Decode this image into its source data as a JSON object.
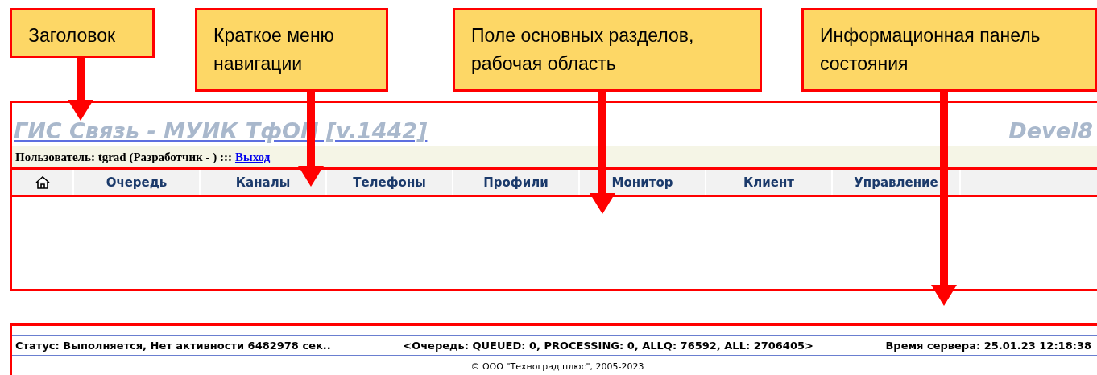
{
  "annotations": [
    {
      "text": "Заголовок"
    },
    {
      "text": "Краткое меню навигации"
    },
    {
      "text": "Поле основных разделов, рабочая область"
    },
    {
      "text": "Информационная панель состояния"
    }
  ],
  "header": {
    "title": "ГИС Связь - МУИК ТфОП [v.1442]",
    "server": "Devel8"
  },
  "user_bar": {
    "text": "Пользователь: tgrad (Разработчик - ) :::",
    "logout_link": "Выход"
  },
  "nav": {
    "items": [
      {
        "label": "Очередь"
      },
      {
        "label": "Каналы"
      },
      {
        "label": "Телефоны"
      },
      {
        "label": "Профили"
      },
      {
        "label": "Монитор"
      },
      {
        "label": "Клиент"
      },
      {
        "label": "Управление"
      }
    ]
  },
  "status_bar": {
    "status": "Статус: Выполняется, Нет активности 6482978 сек..",
    "queue": "<Очередь: QUEUED: 0, PROCESSING: 0, ALLQ: 76592, ALL: 2706405>",
    "server_time": "Время сервера: 25.01.23 12:18:38"
  },
  "footer": {
    "copyright": "© ООО \"Техноград плюс\", 2005-2023"
  }
}
